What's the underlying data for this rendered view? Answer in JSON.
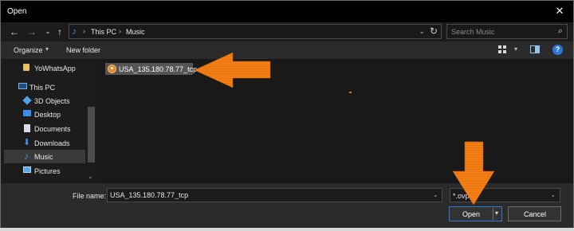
{
  "window": {
    "title": "Open"
  },
  "address": {
    "crumbs": [
      "This PC",
      "Music"
    ]
  },
  "search": {
    "placeholder": "Search Music"
  },
  "toolbar": {
    "organize_label": "Organize",
    "new_folder_label": "New folder",
    "help_label": "?"
  },
  "nav_pane": {
    "items": [
      {
        "label": "YoWhatsApp",
        "icon": "folder-icon",
        "selected": false
      },
      {
        "label": "This PC",
        "icon": "computer-icon",
        "selected": false
      },
      {
        "label": "3D Objects",
        "icon": "3d-objects-icon",
        "selected": false
      },
      {
        "label": "Desktop",
        "icon": "desktop-icon",
        "selected": false
      },
      {
        "label": "Documents",
        "icon": "documents-icon",
        "selected": false
      },
      {
        "label": "Downloads",
        "icon": "downloads-icon",
        "selected": false
      },
      {
        "label": "Music",
        "icon": "music-icon",
        "selected": true
      },
      {
        "label": "Pictures",
        "icon": "pictures-icon",
        "selected": false
      }
    ]
  },
  "files": [
    {
      "name": "USA_135.180.78.77_tcp",
      "icon": "openvpn-config-icon",
      "selected": true
    }
  ],
  "bottom": {
    "file_name_label": "File name:",
    "file_name_value": "USA_135.180.78.77_tcp",
    "filter_value": "*.ovpn",
    "open_label": "Open",
    "cancel_label": "Cancel"
  },
  "colors": {
    "accent": "#2f78d6",
    "annotation_arrow": "#f57f17"
  }
}
